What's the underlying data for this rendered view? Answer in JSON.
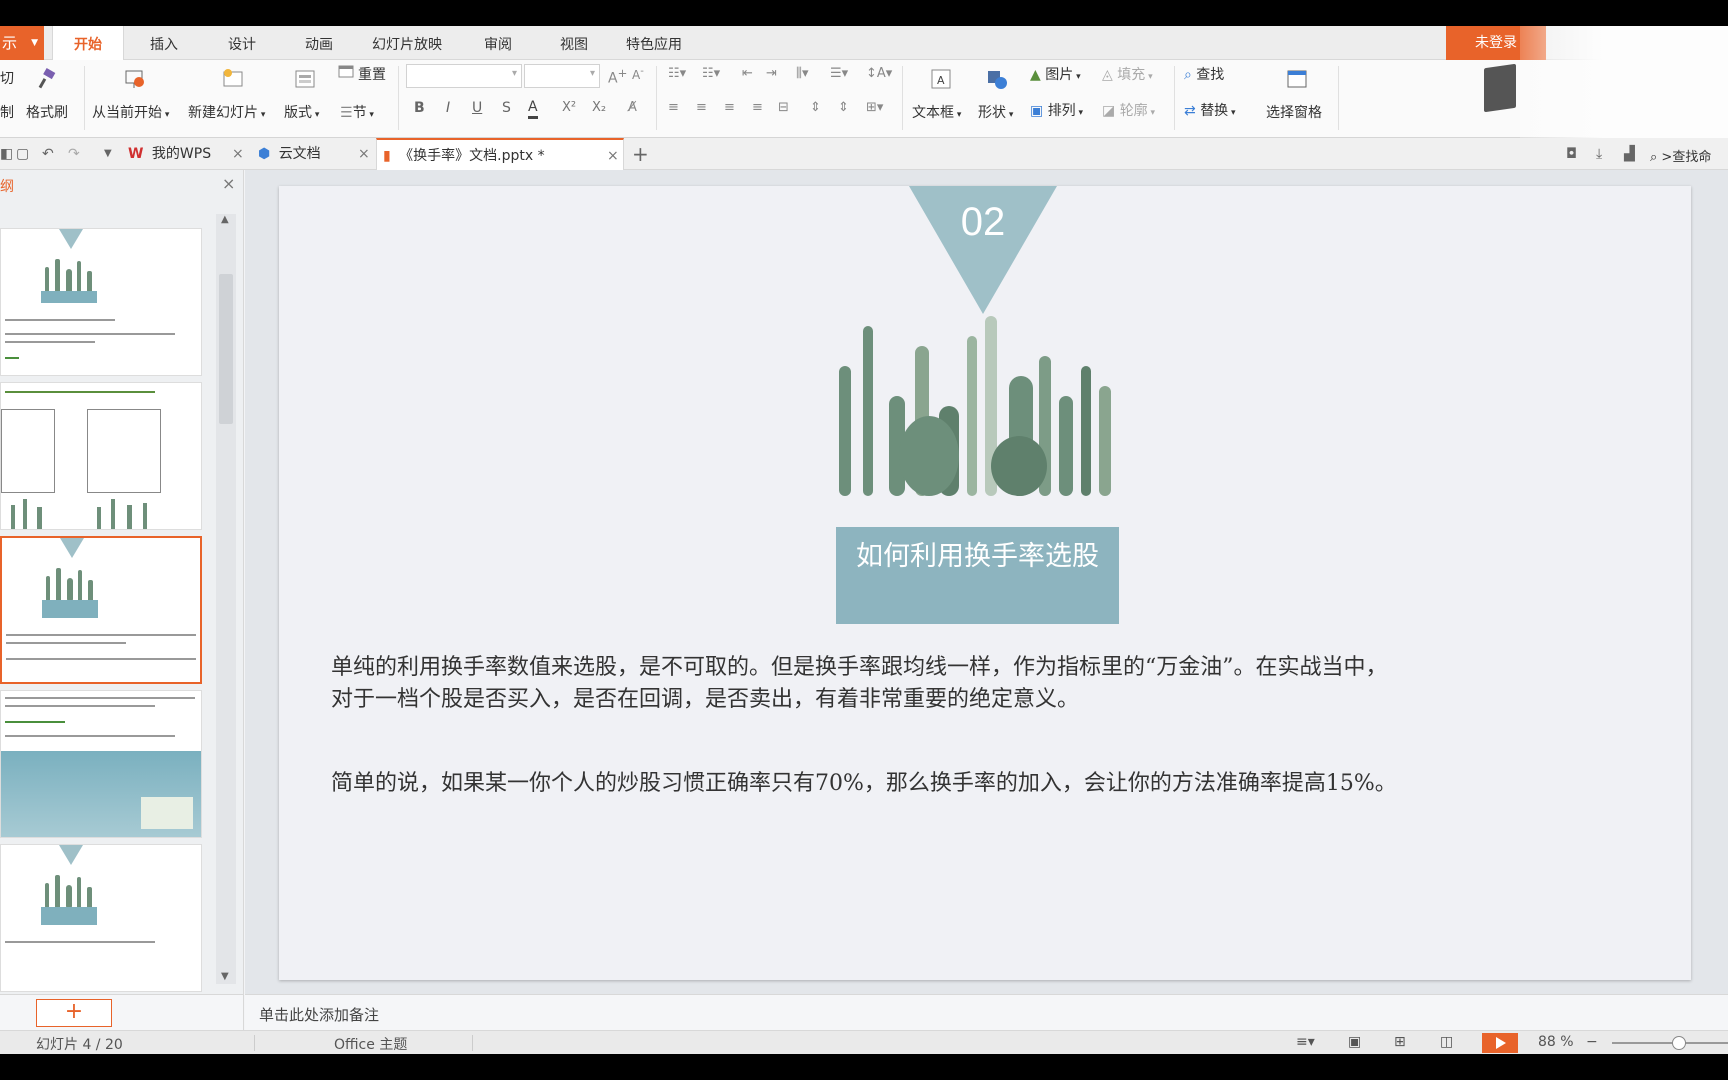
{
  "app_button": {
    "label": "示"
  },
  "ribbon_tabs": [
    {
      "label": "开始",
      "active": true
    },
    {
      "label": "插入"
    },
    {
      "label": "设计"
    },
    {
      "label": "动画"
    },
    {
      "label": "幻灯片放映"
    },
    {
      "label": "审阅"
    },
    {
      "label": "视图"
    },
    {
      "label": "特色应用"
    }
  ],
  "login_label": "未登录",
  "ribbon": {
    "cut": "切",
    "copy": "制",
    "format_painter": "格式刷",
    "from_start": "从当前开始",
    "new_slide": "新建幻灯片",
    "layout": "版式",
    "reset": "重置",
    "section": "节",
    "text_box": "文本框",
    "shape": "形状",
    "picture": "图片",
    "fill": "填充",
    "arrange": "排列",
    "outline": "轮廓",
    "find": "查找",
    "replace": "替换",
    "selection_pane": "选择窗格",
    "font_buttons": [
      "B",
      "I",
      "U",
      "S",
      "A",
      "X²",
      "X₂"
    ]
  },
  "doc_tabs": [
    {
      "label": "我的WPS"
    },
    {
      "label": "云文档"
    },
    {
      "label": "《换手率》文档.pptx *",
      "active": true
    }
  ],
  "new_tab": "+",
  "search_cmd": ">查找命",
  "panel": {
    "title": "纲",
    "close": "×",
    "add": "+"
  },
  "slide": {
    "number": "02",
    "title": "如何利用换手率选股",
    "paragraph1_line1": "单纯的利用换手率数值来选股，是不可取的。但是换手率跟均线一样，作为指标里的“万金油”。在实战当中，",
    "paragraph1_line2": "对于一档个股是否买入，是否在回调，是否卖出，有着非常重要的绝定意义。",
    "paragraph2": "简单的说，如果某一你个人的炒股习惯正确率只有70%，那么换手率的加入，会让你的方法准确率提高15%。"
  },
  "notes_placeholder": "单击此处添加备注",
  "status": {
    "slide_count": "幻灯片 4 / 20",
    "theme": "Office 主题",
    "zoom": "88 %"
  },
  "colors": {
    "accent": "#e8632a",
    "title_box": "#8db4bf",
    "triangle": "#9fc0c8"
  }
}
